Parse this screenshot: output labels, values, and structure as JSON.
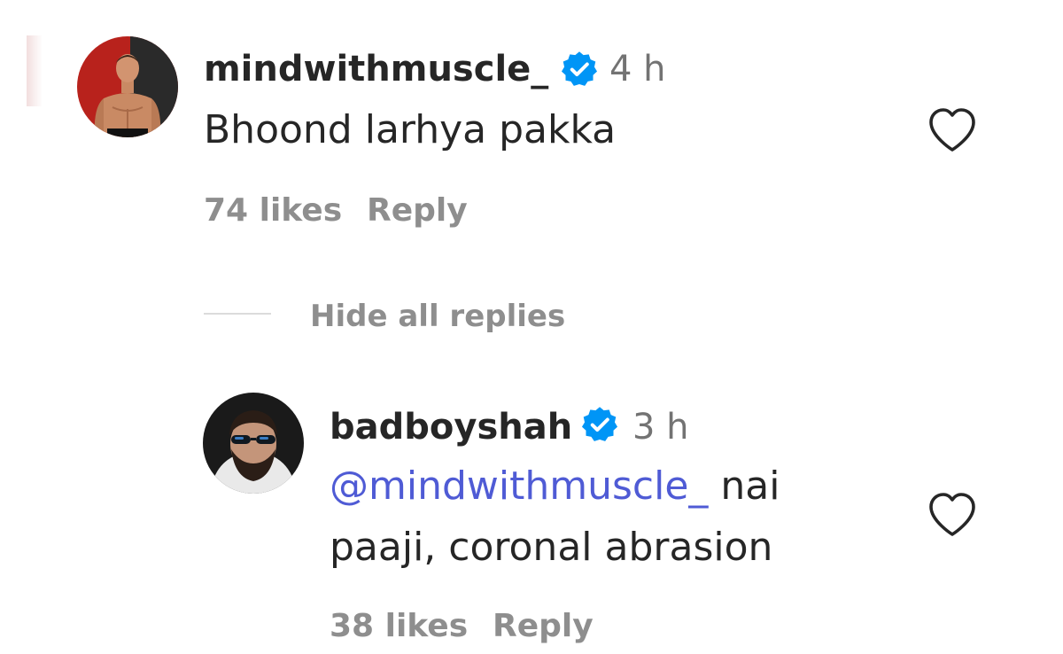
{
  "comments": [
    {
      "username": "mindwithmuscle_",
      "verified": true,
      "time": "4 h",
      "text": "Bhoond larhya pakka",
      "likes": "74 likes",
      "reply_label": "Reply",
      "avatar": "shirtless-man-avatar",
      "like_icon": "heart-outline-icon"
    }
  ],
  "replies_toggle": {
    "label": "Hide all replies"
  },
  "replies": [
    {
      "username": "badboyshah",
      "verified": true,
      "time": "3 h",
      "mention": "@mindwithmuscle_",
      "text_line1_rest": " nai",
      "text_line2": "paaji, coronal abrasion",
      "likes": "38 likes",
      "reply_label": "Reply",
      "avatar": "sunglasses-man-avatar",
      "like_icon": "heart-outline-icon"
    }
  ],
  "colors": {
    "text": "#262626",
    "secondary": "#8e8e8e",
    "mention": "#4f5bd5",
    "verified": "#0095f6"
  }
}
